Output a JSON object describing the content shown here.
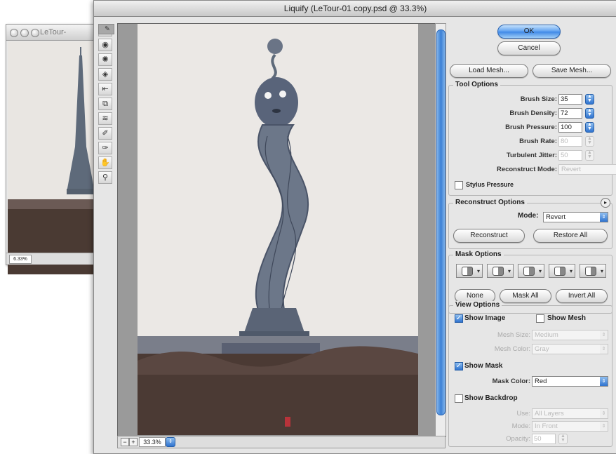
{
  "background_window": {
    "title": "LeTour-",
    "zoom": "6.33%"
  },
  "window": {
    "title": "Liquify (LeTour-01 copy.psd @ 33.3%)"
  },
  "tools": [
    "warp-tool",
    "reconstruct-tool",
    "twirl-tool",
    "pucker-tool",
    "bloat-tool",
    "push-left-tool",
    "mirror-tool",
    "turbulence-tool",
    "freeze-mask-tool",
    "thaw-mask-tool",
    "hand-tool",
    "zoom-tool"
  ],
  "zoom_value": "33.3%",
  "buttons": {
    "ok": "OK",
    "cancel": "Cancel",
    "load_mesh": "Load Mesh...",
    "save_mesh": "Save Mesh..."
  },
  "tool_options": {
    "title": "Tool Options",
    "brush_size": {
      "label": "Brush Size:",
      "value": "35"
    },
    "brush_density": {
      "label": "Brush Density:",
      "value": "72"
    },
    "brush_pressure": {
      "label": "Brush Pressure:",
      "value": "100"
    },
    "brush_rate": {
      "label": "Brush Rate:",
      "value": "80"
    },
    "turbulent_jitter": {
      "label": "Turbulent Jitter:",
      "value": "50"
    },
    "reconstruct_mode": {
      "label": "Reconstruct Mode:",
      "value": "Revert"
    },
    "stylus_pressure": "Stylus Pressure"
  },
  "reconstruct_options": {
    "title": "Reconstruct Options",
    "mode_label": "Mode:",
    "mode_value": "Revert",
    "reconstruct": "Reconstruct",
    "restore_all": "Restore All"
  },
  "mask_options": {
    "title": "Mask Options",
    "none": "None",
    "mask_all": "Mask All",
    "invert_all": "Invert All"
  },
  "view_options": {
    "title": "View Options",
    "show_image": "Show Image",
    "show_mesh": "Show Mesh",
    "mesh_size": {
      "label": "Mesh Size:",
      "value": "Medium"
    },
    "mesh_color": {
      "label": "Mesh Color:",
      "value": "Gray"
    },
    "show_mask": "Show Mask",
    "mask_color": {
      "label": "Mask Color:",
      "value": "Red"
    },
    "show_backdrop": "Show Backdrop",
    "use": {
      "label": "Use:",
      "value": "All Layers"
    },
    "mode": {
      "label": "Mode:",
      "value": "In Front"
    },
    "opacity": {
      "label": "Opacity:",
      "value": "50"
    }
  },
  "colors": {
    "accent_blue": "#3c86e6",
    "sky": "#e9e6e2",
    "tower": "#5e6a7a",
    "trees": "#4a3a33"
  }
}
